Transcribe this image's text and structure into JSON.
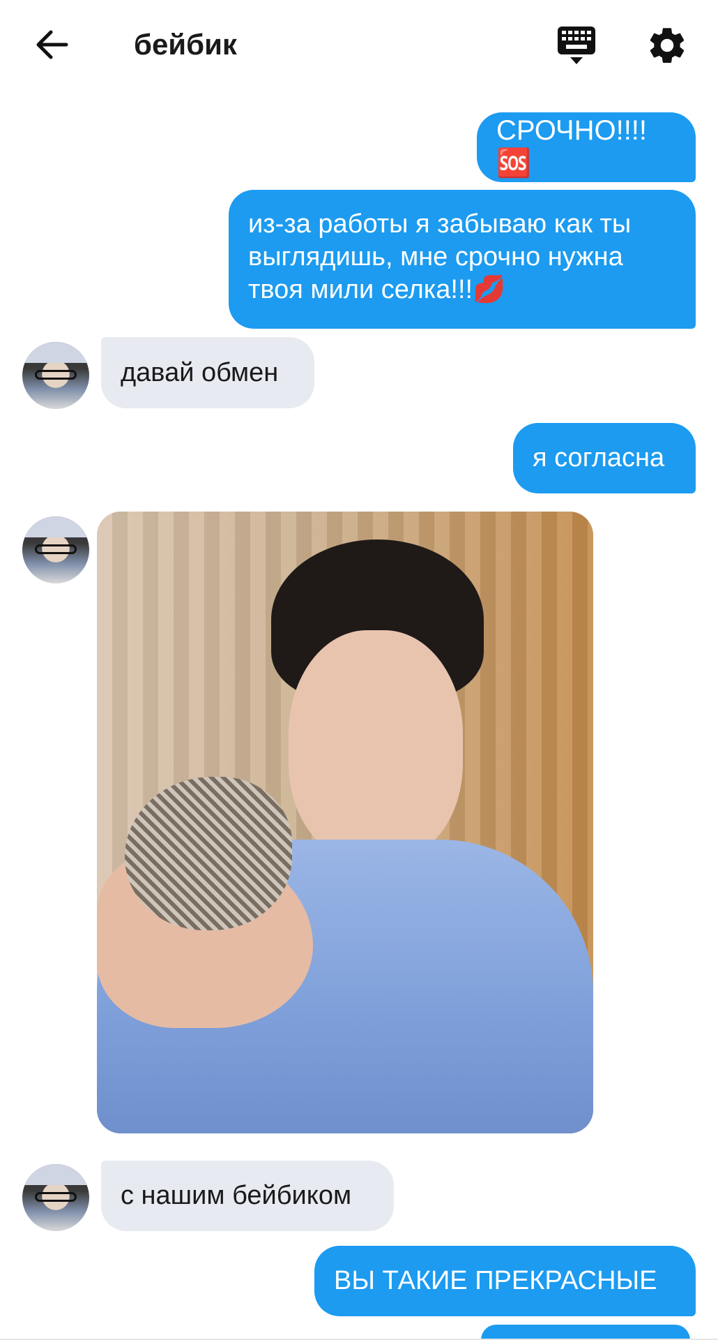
{
  "header": {
    "title": "бейбик",
    "back_icon": "arrow-left-icon",
    "keyboard_icon": "keyboard-icon",
    "settings_icon": "gear-icon"
  },
  "colors": {
    "outgoing_bubble": "#1c9bf0",
    "incoming_bubble": "#e8eaf1",
    "outgoing_text": "#ffffff",
    "incoming_text": "#1a1a1a"
  },
  "messages": [
    {
      "direction": "out",
      "text": "СРОЧНО!!!!🆘"
    },
    {
      "direction": "out",
      "text": "из-за работы я забываю как ты выглядишь, мне срочно нужна твоя мили селка!!!💋"
    },
    {
      "direction": "in",
      "text": "давай обмен"
    },
    {
      "direction": "out",
      "text": "я согласна"
    },
    {
      "direction": "in",
      "type": "photo"
    },
    {
      "direction": "in",
      "text": "с нашим бейбиком"
    },
    {
      "direction": "out",
      "text": "ВЫ ТАКИЕ ПРЕКРАСНЫЕ"
    }
  ]
}
